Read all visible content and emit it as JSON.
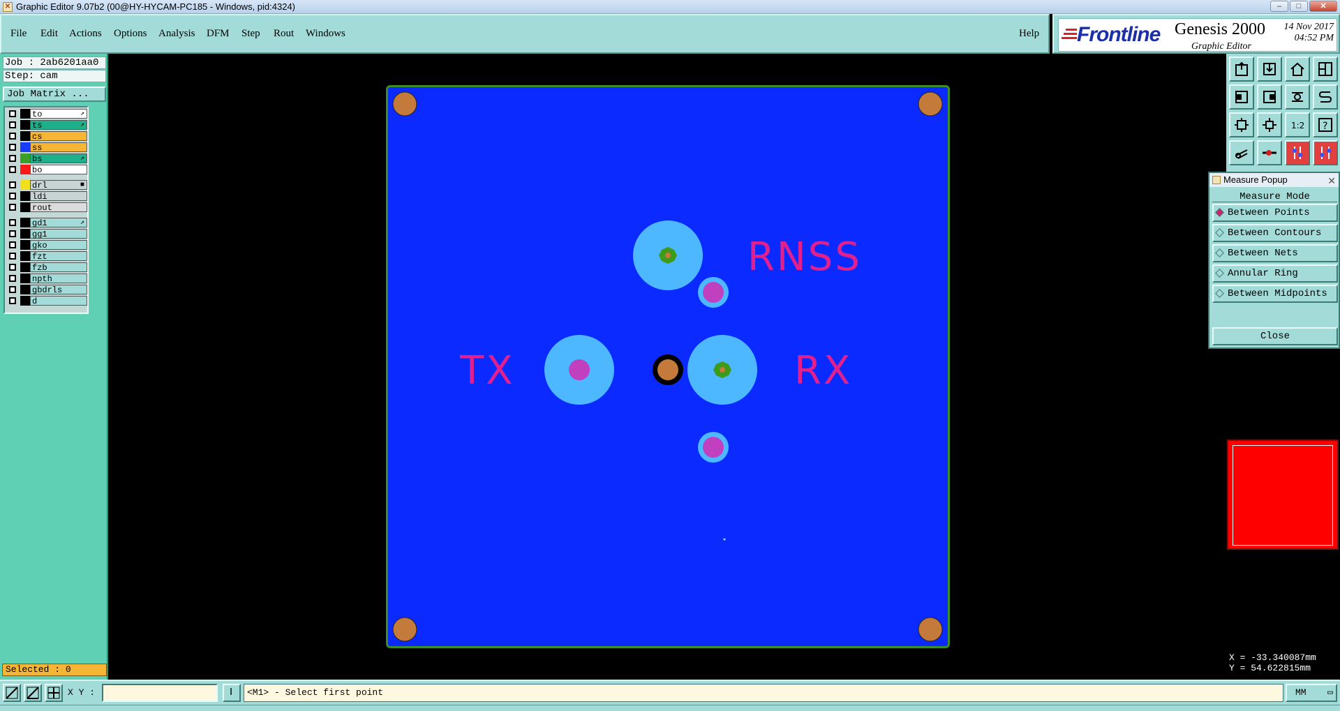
{
  "window": {
    "title": "Graphic Editor 9.07b2 (00@HY-HYCAM-PC185 - Windows, pid:4324)"
  },
  "menu": {
    "items": [
      "File",
      "Edit",
      "Actions",
      "Options",
      "Analysis",
      "DFM",
      "Step",
      "Rout",
      "Windows"
    ],
    "help": "Help"
  },
  "brand": {
    "logo": "Frontline",
    "product": "Genesis 2000",
    "subproduct": "Graphic Editor",
    "date": "14 Nov 2017",
    "time": "04:52 PM"
  },
  "left": {
    "job": "Job : 2ab6201aa0",
    "step": "Step: cam",
    "job_matrix": "Job Matrix ...",
    "selected": "Selected : 0",
    "layers": [
      {
        "name": "to",
        "swatch": "#000000",
        "bg": "#ffffff",
        "mark": "↗"
      },
      {
        "name": "ts",
        "swatch": "#000000",
        "bg": "#1db08a",
        "mark": "↗"
      },
      {
        "name": "cs",
        "swatch": "#000000",
        "bg": "#f6b535",
        "mark": ""
      },
      {
        "name": "ss",
        "swatch": "#1a3cff",
        "bg": "#f6b535",
        "mark": ""
      },
      {
        "name": "bs",
        "swatch": "#3aa02a",
        "bg": "#1db08a",
        "mark": "↗"
      },
      {
        "name": "bo",
        "swatch": "#ff1a1a",
        "bg": "#ffffff",
        "mark": ""
      },
      {
        "name": "drl",
        "swatch": "#f2e11a",
        "bg": "#c8d4d4",
        "mark": "■"
      },
      {
        "name": "ldi",
        "swatch": "#000000",
        "bg": "#c8d4d4",
        "mark": ""
      },
      {
        "name": "rout",
        "swatch": "#000000",
        "bg": "#dcdcdc",
        "mark": ""
      },
      {
        "name": "gd1",
        "swatch": "#000000",
        "bg": "#a2dbd7",
        "mark": "↗"
      },
      {
        "name": "gg1",
        "swatch": "#000000",
        "bg": "#a2dbd7",
        "mark": ""
      },
      {
        "name": "gko",
        "swatch": "#000000",
        "bg": "#a2dbd7",
        "mark": ""
      },
      {
        "name": "fzt",
        "swatch": "#000000",
        "bg": "#a2dbd7",
        "mark": ""
      },
      {
        "name": "fzb",
        "swatch": "#000000",
        "bg": "#a2dbd7",
        "mark": ""
      },
      {
        "name": "npth",
        "swatch": "#000000",
        "bg": "#a2dbd7",
        "mark": ""
      },
      {
        "name": "gbdrls",
        "swatch": "#000000",
        "bg": "#a2dbd7",
        "mark": ""
      },
      {
        "name": "d",
        "swatch": "#000000",
        "bg": "#a2dbd7",
        "mark": ""
      }
    ]
  },
  "board": {
    "labels": {
      "rnss": "RNSS",
      "tx": "TX",
      "rx": "RX"
    },
    "colors": {
      "board": "#0a2aff",
      "pad": "#4db8ff",
      "silk": "#e0208f",
      "copper": "#c47a3a",
      "green": "#3e9a1a"
    }
  },
  "measure_popup": {
    "title": "Measure Popup",
    "mode_label": "Measure Mode",
    "options": [
      "Between Points",
      "Between Contours",
      "Between Nets",
      "Annular Ring",
      "Between Midpoints"
    ],
    "selected_option": "Between Points",
    "close": "Close"
  },
  "coords": {
    "x": "X = -33.340087mm",
    "y": "Y = 54.622815mm"
  },
  "status": {
    "xy_label": "X Y :",
    "xy_value": "",
    "prompt": "<M1> - Select first point",
    "units": "MM"
  }
}
